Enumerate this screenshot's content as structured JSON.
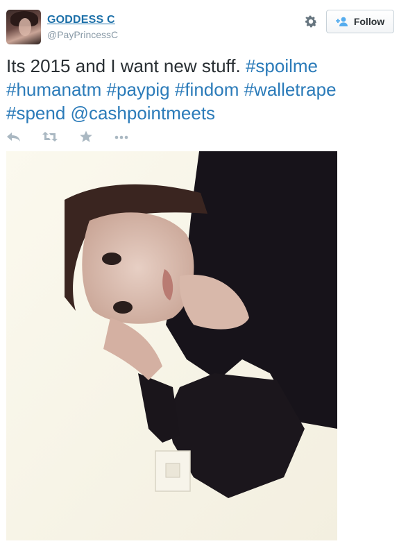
{
  "header": {
    "display_name": "GODDESS C",
    "screen_name": "@PayPrincessC",
    "follow_label": "Follow"
  },
  "tweet": {
    "text_plain": "Its 2015 and I want new stuff.",
    "hashtags": [
      "#spoilme",
      "#humanatm",
      "#paypig",
      "#findom",
      "#walletrape",
      "#spend"
    ],
    "mention": "@cashpointmeets"
  },
  "icons": {
    "gear": "gear-icon",
    "follow": "add-user-icon",
    "reply": "reply-icon",
    "retweet": "retweet-icon",
    "favorite": "star-icon",
    "more": "more-icon"
  },
  "colors": {
    "name_link": "#1b6fa8",
    "link": "#2b7bb9",
    "muted": "#8899a6",
    "text": "#292f33"
  }
}
